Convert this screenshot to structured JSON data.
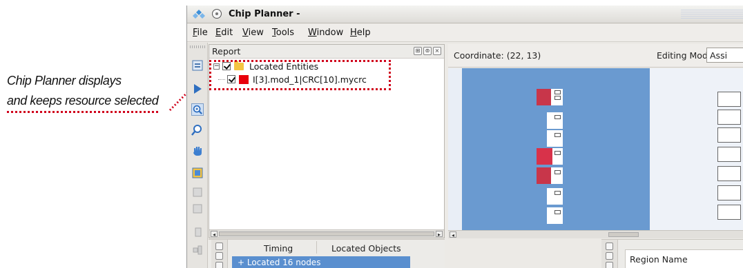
{
  "callout": {
    "line1": "Chip Planner displays",
    "line2": "and keeps resource selected"
  },
  "window": {
    "title": "Chip Planner -"
  },
  "menu": [
    "File",
    "Edit",
    "View",
    "Tools",
    "Window",
    "Help"
  ],
  "toolbar_icons": [
    "properties-icon",
    "select-arrow-icon",
    "zoom-in-icon",
    "zoom-icon",
    "hand-pan-icon",
    "fit-icon",
    "tool-icon",
    "tool-icon",
    "tool-icon"
  ],
  "report": {
    "title": "Report",
    "tree": {
      "root": "Located Entities",
      "child": "I[3].mod_1|CRC[10].mycrc"
    }
  },
  "viewer": {
    "coordinate": "Coordinate: (22, 13)",
    "editing_mode_label": "Editing Mode:",
    "editing_mode_value": "Assi"
  },
  "bottom": {
    "tabs": [
      "Timing",
      "Located Objects"
    ],
    "selected_row": "+ Located 16 nodes",
    "region_header": "Region Name"
  },
  "colors": {
    "highlight": "#d0021b",
    "canvas": "#6a9ad0",
    "selection": "#5a8fcf"
  }
}
